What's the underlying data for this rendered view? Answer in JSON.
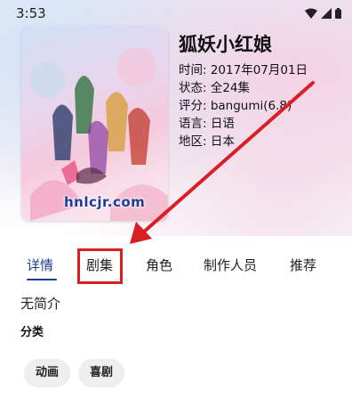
{
  "status_bar": {
    "time": "3:53"
  },
  "anime": {
    "title": "狐妖小红娘",
    "info": [
      {
        "key": "时间: ",
        "value": "2017年07月01日"
      },
      {
        "key": "状态: ",
        "value": "全24集"
      },
      {
        "key": "评分: ",
        "value": "bangumi(6.8)"
      },
      {
        "key": "语言: ",
        "value": "日语"
      },
      {
        "key": "地区: ",
        "value": "日本"
      }
    ]
  },
  "poster": {
    "brand_text": "hnlcjr.com"
  },
  "tabs": [
    {
      "label": "详情",
      "active": true
    },
    {
      "label": "剧集",
      "active": false
    },
    {
      "label": "角色",
      "active": false
    },
    {
      "label": "制作人员",
      "active": false
    },
    {
      "label": "推荐",
      "active": false
    }
  ],
  "details": {
    "intro": "无简介",
    "category_title": "分类",
    "categories": [
      "动画",
      "喜剧"
    ]
  },
  "colors": {
    "accent": "#1a3d8f",
    "annotation_red": "#d81f26"
  },
  "icons": [
    "wifi-icon",
    "signal-icon",
    "battery-icon"
  ]
}
